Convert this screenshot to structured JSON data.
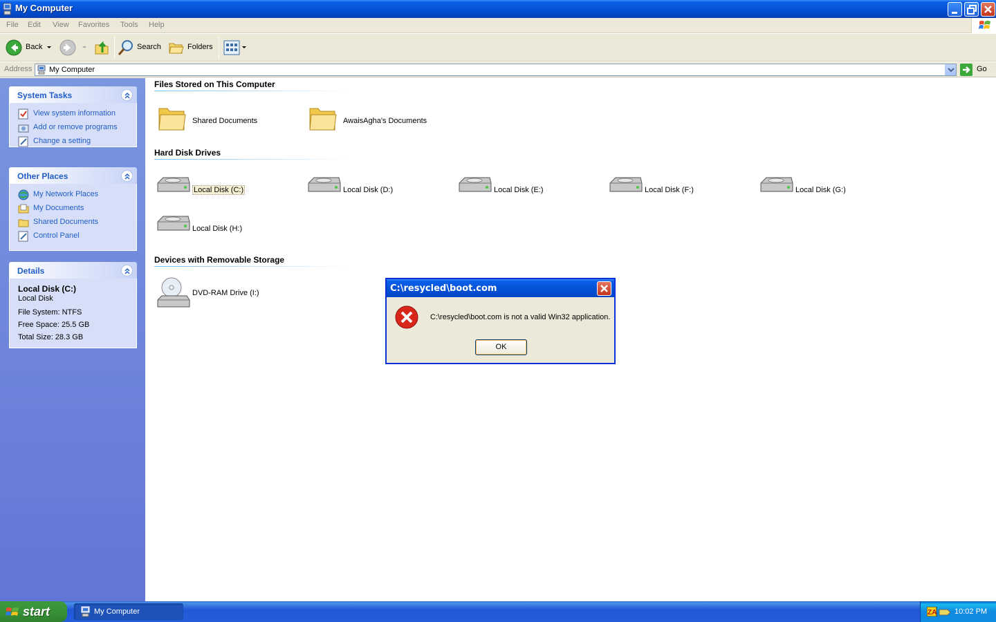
{
  "window": {
    "title": "My Computer"
  },
  "menu": [
    "File",
    "Edit",
    "View",
    "Favorites",
    "Tools",
    "Help"
  ],
  "toolbar": {
    "back_label": "Back",
    "search_label": "Search",
    "folders_label": "Folders"
  },
  "address": {
    "label": "Address",
    "value": "My Computer",
    "go_label": "Go"
  },
  "sidebar": {
    "system_tasks": {
      "title": "System Tasks",
      "items": [
        "View system information",
        "Add or remove programs",
        "Change a setting"
      ]
    },
    "other_places": {
      "title": "Other Places",
      "items": [
        "My Network Places",
        "My Documents",
        "Shared Documents",
        "Control Panel"
      ]
    },
    "details": {
      "title": "Details",
      "name": "Local Disk (C:)",
      "type": "Local Disk",
      "file_system": "File System: NTFS",
      "free_space": "Free Space: 25.5 GB",
      "total_size": "Total Size: 28.3 GB"
    }
  },
  "content": {
    "groups": {
      "files": {
        "title": "Files Stored on This Computer",
        "items": [
          "Shared Documents",
          "AwaisAgha's Documents"
        ]
      },
      "drives": {
        "title": "Hard Disk Drives",
        "items": [
          "Local Disk (C:)",
          "Local Disk (D:)",
          "Local Disk (E:)",
          "Local Disk (F:)",
          "Local Disk (G:)",
          "Local Disk (H:)"
        ]
      },
      "removable": {
        "title": "Devices with Removable Storage",
        "items": [
          "DVD-RAM Drive (I:)"
        ]
      }
    }
  },
  "dialog": {
    "title": "C:\\resycled\\boot.com",
    "message": "C:\\resycled\\boot.com is not a valid Win32 application.",
    "ok_label": "OK"
  },
  "taskbar": {
    "start_label": "start",
    "task_label": "My Computer",
    "clock": "10:02 PM"
  }
}
